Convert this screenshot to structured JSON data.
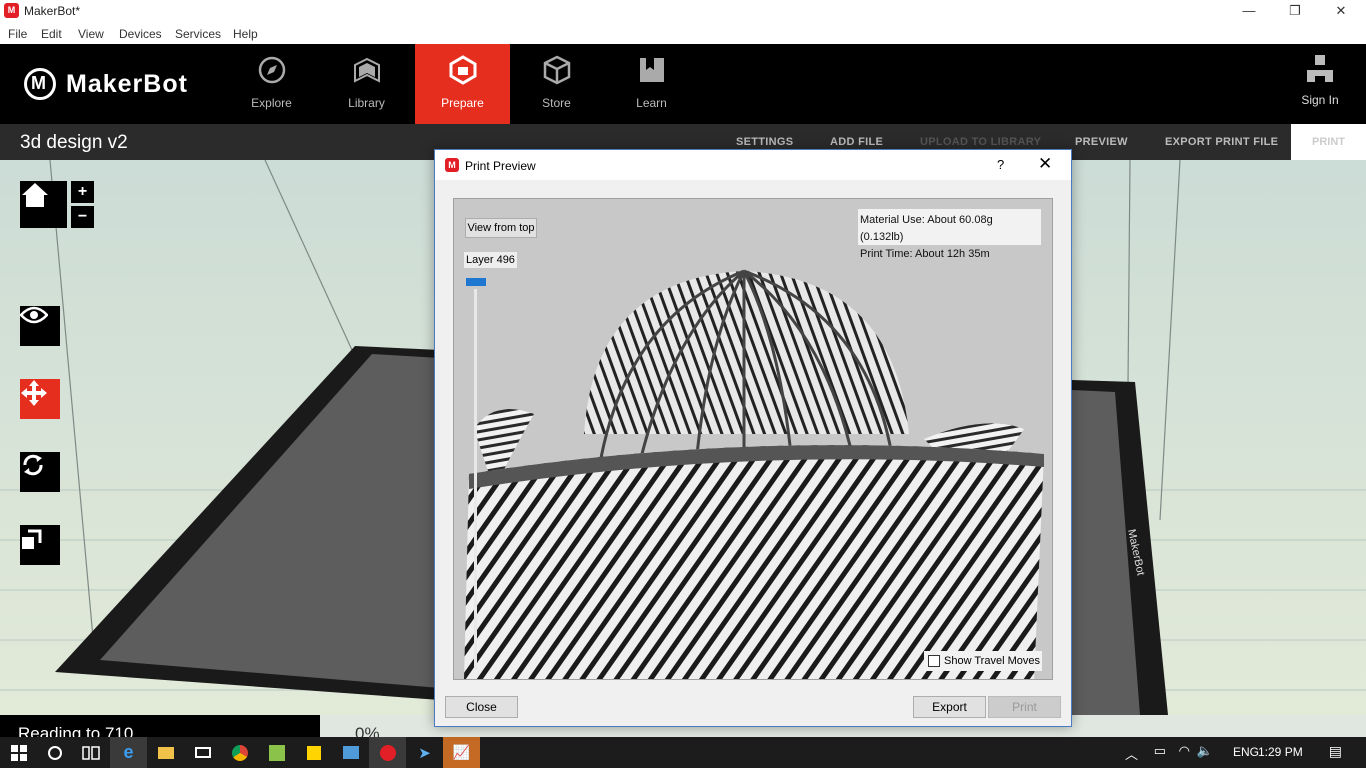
{
  "window": {
    "title": "MakerBot*",
    "minimize": "—",
    "restore": "❐",
    "close": "✕"
  },
  "menu": [
    "File",
    "Edit",
    "View",
    "Devices",
    "Services",
    "Help"
  ],
  "header": {
    "logo_text": "MakerBot",
    "nav": [
      {
        "label": "Explore",
        "icon": "compass-icon",
        "active": false
      },
      {
        "label": "Library",
        "icon": "library-icon",
        "active": false
      },
      {
        "label": "Prepare",
        "icon": "prepare-icon",
        "active": true
      },
      {
        "label": "Store",
        "icon": "store-icon",
        "active": false
      },
      {
        "label": "Learn",
        "icon": "learn-icon",
        "active": false
      }
    ],
    "sign_in": "Sign In",
    "accent": "#e62e1f"
  },
  "subbar": {
    "project_name": "3d design v2",
    "actions": [
      "SETTINGS",
      "ADD FILE",
      "UPLOAD TO LIBRARY",
      "PREVIEW",
      "EXPORT PRINT FILE"
    ],
    "print": "PRINT"
  },
  "toolbar": {
    "zoom_in": "+",
    "zoom_out": "−"
  },
  "status": {
    "left": "Reading to 710",
    "percent": "0%"
  },
  "dialog": {
    "title": "Print Preview",
    "help": "?",
    "close_x": "✕",
    "view_from_top": "View from top",
    "material_use": "Material Use: About 60.08g (0.132lb)",
    "print_time": "Print Time: About 12h 35m",
    "layer_label": "Layer 496",
    "show_travel_moves": "Show Travel Moves",
    "show_travel_checked": false,
    "buttons": {
      "close": "Close",
      "export": "Export",
      "print": "Print"
    }
  },
  "taskbar": {
    "tray_lang": "ENG",
    "time": "1:29 PM"
  }
}
